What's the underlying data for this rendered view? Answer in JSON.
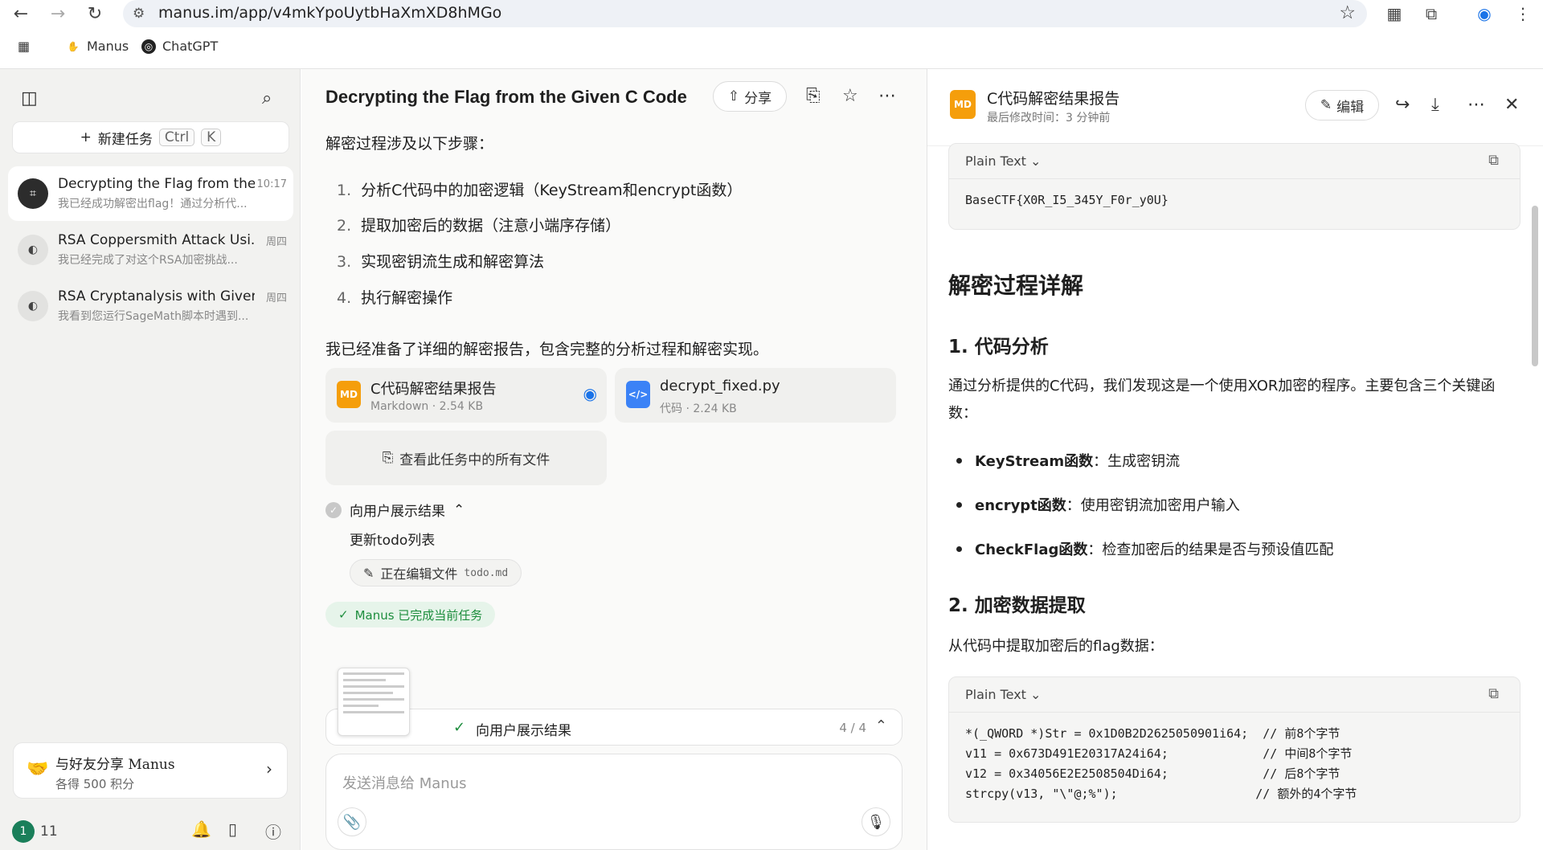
{
  "browser": {
    "url": "manus.im/app/v4mkYpoUytbHaXmXD8hMGo",
    "bookmarks": [
      "Manus",
      "ChatGPT"
    ]
  },
  "sidebar": {
    "new_task": "新建任务",
    "shortcut_ctrl": "Ctrl",
    "shortcut_k": "K",
    "tasks": [
      {
        "title": "Decrypting the Flag from the ...",
        "time": "10:17",
        "sub": "我已经成功解密出flag！通过分析代..."
      },
      {
        "title": "RSA Coppersmith Attack Usi...",
        "time": "周四",
        "sub": "我已经完成了对这个RSA加密挑战..."
      },
      {
        "title": "RSA Cryptanalysis with Given...",
        "time": "周四",
        "sub": "我看到您运行SageMath脚本时遇到..."
      }
    ],
    "share_title": "与好友分享 Manus",
    "share_sub": "各得 500 积分",
    "badge": "1",
    "count": "11"
  },
  "chat": {
    "title": "Decrypting the Flag from the Given C Code",
    "share_label": "分享",
    "intro": "解密过程涉及以下步骤：",
    "steps": [
      {
        "n": "1.",
        "text": "分析C代码中的加密逻辑（KeyStream和encrypt函数）"
      },
      {
        "n": "2.",
        "text": "提取加密后的数据（注意小端序存储）"
      },
      {
        "n": "3.",
        "text": "实现密钥流生成和解密算法"
      },
      {
        "n": "4.",
        "text": "执行解密操作"
      }
    ],
    "prepared": "我已经准备了详细的解密报告，包含完整的分析过程和解密实现。",
    "files": [
      {
        "icon": "MD",
        "name": "C代码解密结果报告",
        "meta": "Markdown · 2.54 KB"
      },
      {
        "icon": "</>",
        "name": "decrypt_fixed.py",
        "meta": "代码 · 2.24 KB"
      }
    ],
    "all_files": "查看此任务中的所有文件",
    "step_title": "向用户展示结果",
    "step_sub": "更新todo列表",
    "editing_label": "正在编辑文件",
    "editing_file": "todo.md",
    "done_label": "Manus 已完成当前任务",
    "progress_label": "向用户展示结果",
    "progress_count": "4 / 4",
    "input_placeholder": "发送消息给 Manus"
  },
  "doc": {
    "icon": "MD",
    "title": "C代码解密结果报告",
    "subtitle": "最后修改时间：3 分钟前",
    "edit_label": "编辑",
    "code1_lang": "Plain Text",
    "code1_line": "BaseCTF{X0R_I5_345Y_F0r_y0U}",
    "h2": "解密过程详解",
    "h3_1": "1. 代码分析",
    "para1": "通过分析提供的C代码，我们发现这是一个使用XOR加密的程序。主要包含三个关键函数：",
    "bullets": [
      {
        "term": "KeyStream函数",
        "desc": "：生成密钥流"
      },
      {
        "term": "encrypt函数",
        "desc": "：使用密钥流加密用户输入"
      },
      {
        "term": "CheckFlag函数",
        "desc": "：检查加密后的结果是否与预设值匹配"
      }
    ],
    "h3_2": "2. 加密数据提取",
    "para2": "从代码中提取加密后的flag数据：",
    "code2_lang": "Plain Text",
    "code2_lines": [
      "*(_QWORD *)Str = 0x1D0B2D2625050901i64;  // 前8个字节",
      "v11 = 0x673D491E20317A24i64;             // 中间8个字节",
      "v12 = 0x34056E2E2508504Di64;             // 后8个字节",
      "strcpy(v13, \"\\\"@;%\");                   // 额外的4个字节"
    ]
  }
}
